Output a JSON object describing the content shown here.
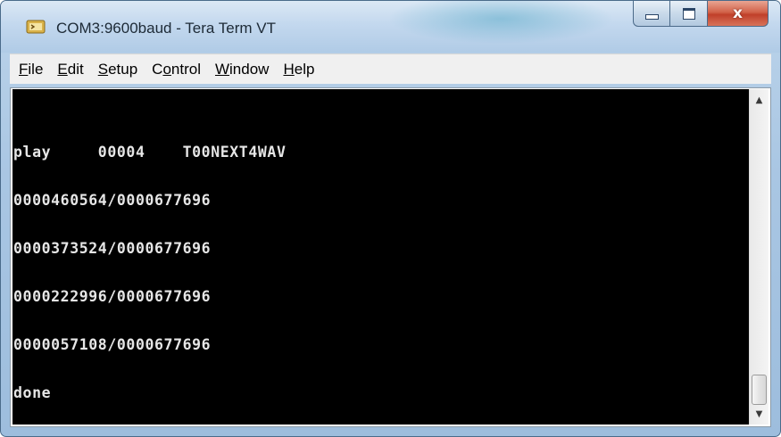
{
  "window": {
    "title": "COM3:9600baud - Tera Term VT",
    "icon": "tera-term-app-icon"
  },
  "caption_buttons": {
    "minimize_icon": "minimize-icon",
    "maximize_icon": "maximize-icon",
    "close_icon": "close-icon",
    "close_glyph": "x"
  },
  "menu": {
    "items": [
      {
        "label_pre": "",
        "accel": "F",
        "label_post": "ile"
      },
      {
        "label_pre": "",
        "accel": "E",
        "label_post": "dit"
      },
      {
        "label_pre": "",
        "accel": "S",
        "label_post": "etup"
      },
      {
        "label_pre": "C",
        "accel": "o",
        "label_post": "ntrol"
      },
      {
        "label_pre": "",
        "accel": "W",
        "label_post": "indow"
      },
      {
        "label_pre": "",
        "accel": "H",
        "label_post": "elp"
      }
    ]
  },
  "terminal": {
    "lines": [
      "play     00004    T00NEXT4WAV",
      "0000460564/0000677696",
      "0000373524/0000677696",
      "0000222996/0000677696",
      "0000057108/0000677696",
      "done"
    ],
    "background": "#000000",
    "foreground": "#e6e6e6"
  },
  "scrollbar": {
    "up_glyph": "▲",
    "down_glyph": "▼",
    "position": 1.0
  }
}
